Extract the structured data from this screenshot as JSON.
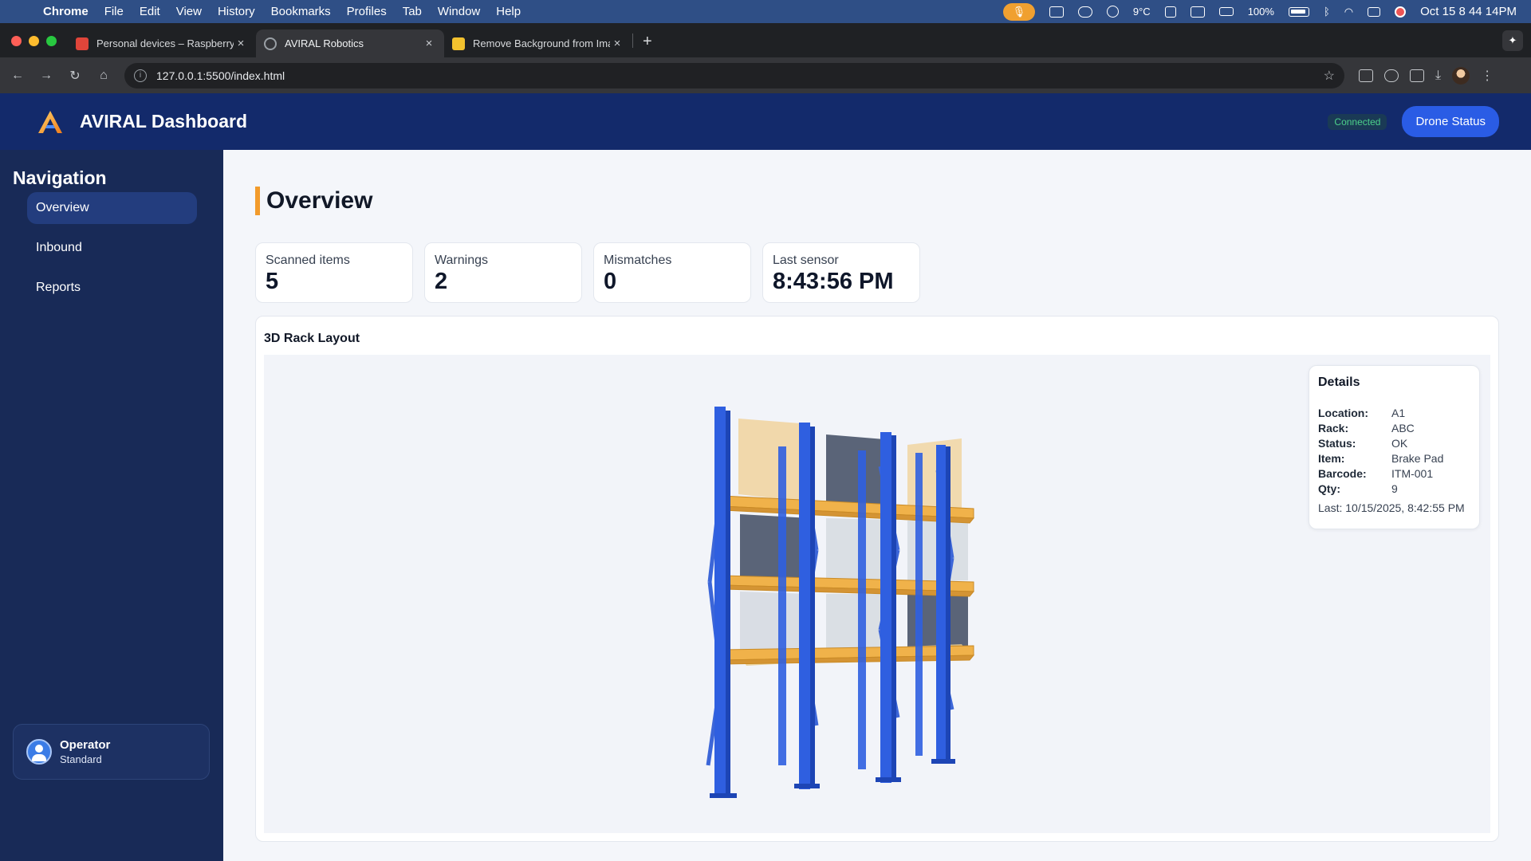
{
  "menubar": {
    "app": "Chrome",
    "items": [
      "File",
      "Edit",
      "View",
      "History",
      "Bookmarks",
      "Profiles",
      "Tab",
      "Window",
      "Help"
    ],
    "temperature": "9°C",
    "battery": "100%",
    "datetime": "Oct 15  8 44 14PM"
  },
  "tabs": [
    {
      "title": "Personal devices – Raspberry",
      "close": "×",
      "favicon_color": "#e0453a"
    },
    {
      "title": "AVIRAL Robotics",
      "close": "×",
      "favicon_color": "#9aa0a6"
    },
    {
      "title": "Remove Background from Ima",
      "close": "×",
      "favicon_color": "#f2c12e"
    }
  ],
  "toolbar": {
    "url": "127.0.0.1:5500/index.html"
  },
  "header": {
    "title": "AVIRAL Dashboard",
    "connection": "Connected",
    "drone_button": "Drone Status"
  },
  "sidebar": {
    "title": "Navigation",
    "items": [
      {
        "label": "Overview",
        "active": true
      },
      {
        "label": "Inbound",
        "active": false
      },
      {
        "label": "Reports",
        "active": false
      }
    ],
    "user": {
      "name": "Operator",
      "role": "Standard"
    }
  },
  "main": {
    "title": "Overview",
    "stats": [
      {
        "label": "Scanned items",
        "value": "5"
      },
      {
        "label": "Warnings",
        "value": "2"
      },
      {
        "label": "Mismatches",
        "value": "0"
      },
      {
        "label": "Last sensor",
        "value": "8:43:56 PM"
      }
    ],
    "rack": {
      "title": "3D Rack Layout",
      "details": {
        "title": "Details",
        "rows": [
          {
            "key": "Location:",
            "value": "A1"
          },
          {
            "key": "Rack:",
            "value": "ABC"
          },
          {
            "key": "Status:",
            "value": "OK"
          },
          {
            "key": "Item:",
            "value": "Brake Pad"
          },
          {
            "key": "Barcode:",
            "value": "ITM-001"
          },
          {
            "key": "Qty:",
            "value": "9"
          }
        ],
        "last": "Last: 10/15/2025, 8:42:55 PM"
      }
    }
  },
  "colors": {
    "header_bg": "#132a6b",
    "sidebar_bg": "#182a57",
    "accent": "#f29b2b",
    "button": "#2a5ce5",
    "rack_frame": "#2f5fe0",
    "rack_beam": "#f0b24a"
  }
}
